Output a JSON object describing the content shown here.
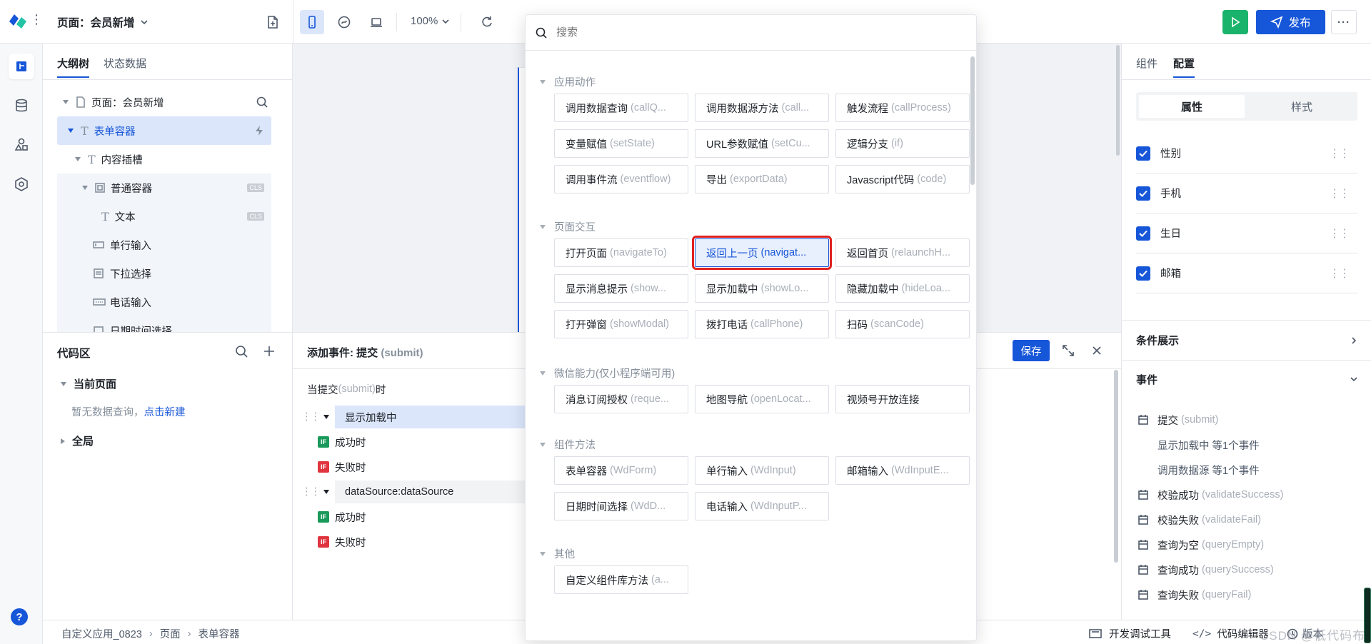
{
  "topbar": {
    "page_title": "页面：会员新增",
    "zoom": "100%",
    "publish_label": "发布"
  },
  "outline": {
    "tabs": [
      "大纲树",
      "状态数据"
    ],
    "nodes": [
      {
        "label": "页面：会员新增"
      },
      {
        "label": "表单容器"
      },
      {
        "label": "内容插槽"
      },
      {
        "label": "普通容器",
        "tag": "CLS"
      },
      {
        "label": "文本",
        "tag": "CLS"
      },
      {
        "label": "单行输入"
      },
      {
        "label": "下拉选择"
      },
      {
        "label": "电话输入"
      },
      {
        "label": "日期时间选择"
      }
    ]
  },
  "codearea": {
    "title": "代码区",
    "current_page": "当前页面",
    "empty_text": "暂无数据查询，",
    "create_link": "点击新建",
    "global": "全局"
  },
  "eventpanel": {
    "title": "添加事件: 提交",
    "title_en": "(submit)",
    "save_label": "保存",
    "when_prefix": "当提交",
    "when_en": "(submit)",
    "when_suffix": "时",
    "action1": "显示加载中",
    "success": "成功时",
    "fail": "失败时",
    "action2": "dataSource:dataSource",
    "if_badge": "IF"
  },
  "dropdown": {
    "search_placeholder": "搜索",
    "sections": [
      {
        "title": "应用动作",
        "items": [
          {
            "cn": "调用数据查询",
            "en": "(callQ..."
          },
          {
            "cn": "调用数据源方法",
            "en": "(call..."
          },
          {
            "cn": "触发流程",
            "en": "(callProcess)"
          },
          {
            "cn": "变量赋值",
            "en": "(setState)"
          },
          {
            "cn": "URL参数赋值",
            "en": "(setCu..."
          },
          {
            "cn": "逻辑分支",
            "en": "(if)"
          },
          {
            "cn": "调用事件流",
            "en": "(eventflow)"
          },
          {
            "cn": "导出",
            "en": "(exportData)"
          },
          {
            "cn": "Javascript代码",
            "en": "(code)"
          }
        ]
      },
      {
        "title": "页面交互",
        "items": [
          {
            "cn": "打开页面",
            "en": "(navigateTo)"
          },
          {
            "cn": "返回上一页",
            "en": "(navigat..."
          },
          {
            "cn": "返回首页",
            "en": "(relaunchH..."
          },
          {
            "cn": "显示消息提示",
            "en": "(show..."
          },
          {
            "cn": "显示加载中",
            "en": "(showLo..."
          },
          {
            "cn": "隐藏加载中",
            "en": "(hideLoa..."
          },
          {
            "cn": "打开弹窗",
            "en": "(showModal)"
          },
          {
            "cn": "拨打电话",
            "en": "(callPhone)"
          },
          {
            "cn": "扫码",
            "en": "(scanCode)"
          }
        ]
      },
      {
        "title": "微信能力(仅小程序端可用)",
        "items": [
          {
            "cn": "消息订阅授权",
            "en": "(reque..."
          },
          {
            "cn": "地图导航",
            "en": "(openLocat..."
          },
          {
            "cn": "视频号开放连接",
            "en": ""
          }
        ]
      },
      {
        "title": "组件方法",
        "items": [
          {
            "cn": "表单容器",
            "en": "(WdForm)"
          },
          {
            "cn": "单行输入",
            "en": "(WdInput)"
          },
          {
            "cn": "邮箱输入",
            "en": "(WdInputE..."
          },
          {
            "cn": "日期时间选择",
            "en": "(WdD..."
          },
          {
            "cn": "电话输入",
            "en": "(WdInputP..."
          }
        ]
      },
      {
        "title": "其他",
        "items": [
          {
            "cn": "自定义组件库方法",
            "en": "(a..."
          }
        ]
      }
    ]
  },
  "rightpanel": {
    "tabs": [
      "组件",
      "配置"
    ],
    "seg": [
      "属性",
      "样式"
    ],
    "fields": [
      "性别",
      "手机",
      "生日",
      "邮箱"
    ],
    "condition_title": "条件展示",
    "events_title": "事件",
    "events": [
      {
        "cn": "提交",
        "en": "(submit)",
        "icon": true
      },
      {
        "cn": "显示加载中 等1个事件",
        "en": "",
        "icon": false
      },
      {
        "cn": "调用数据源 等1个事件",
        "en": "",
        "icon": false
      },
      {
        "cn": "校验成功",
        "en": "(validateSuccess)",
        "icon": true
      },
      {
        "cn": "校验失败",
        "en": "(validateFail)",
        "icon": true
      },
      {
        "cn": "查询为空",
        "en": "(queryEmpty)",
        "icon": true
      },
      {
        "cn": "查询成功",
        "en": "(querySuccess)",
        "icon": true
      },
      {
        "cn": "查询失败",
        "en": "(queryFail)",
        "icon": true
      }
    ]
  },
  "bottombar": {
    "breadcrumb": [
      "自定义应用_0823",
      "页面",
      "表单容器"
    ],
    "devtools": "开发调试工具",
    "code_editor": "代码编辑器",
    "version": "版本"
  },
  "watermark": "CSDN @低代码布道师",
  "help": "?",
  "colors": {
    "primary": "#1656d8",
    "run": "#19b36b",
    "if_green": "#1a9a5a",
    "if_red": "#e0353f",
    "highlight_border": "#e02020"
  }
}
